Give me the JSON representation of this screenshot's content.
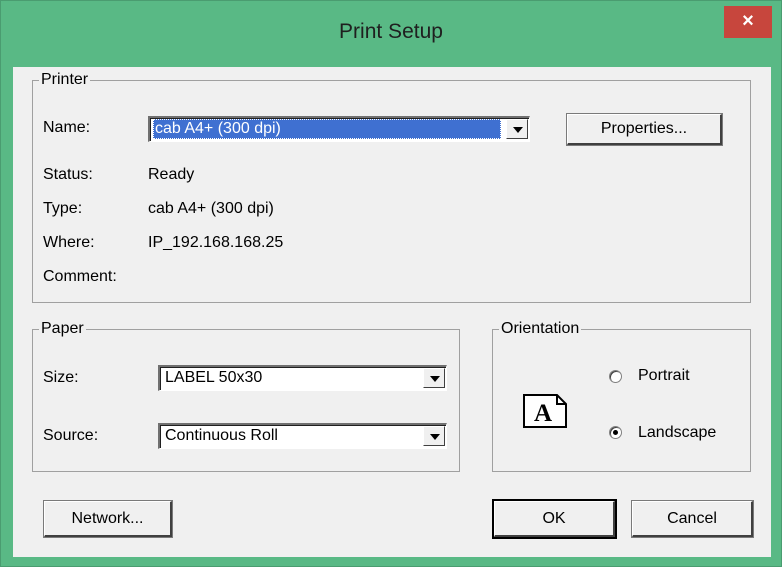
{
  "window": {
    "title": "Print Setup",
    "close_glyph": "×"
  },
  "printer": {
    "group_label": "Printer",
    "name_label": "Name:",
    "name_value": "cab A4+ (300 dpi)",
    "properties_button": "Properties...",
    "status_label": "Status:",
    "status_value": "Ready",
    "type_label": "Type:",
    "type_value": "cab A4+ (300 dpi)",
    "where_label": "Where:",
    "where_value": "IP_192.168.168.25",
    "comment_label": "Comment:",
    "comment_value": ""
  },
  "paper": {
    "group_label": "Paper",
    "size_label": "Size:",
    "size_value": "LABEL 50x30",
    "source_label": "Source:",
    "source_value": "Continuous Roll"
  },
  "orientation": {
    "group_label": "Orientation",
    "portrait_label": "Portrait",
    "landscape_label": "Landscape",
    "selected": "Landscape",
    "icon_letter": "A"
  },
  "buttons": {
    "network": "Network...",
    "ok": "OK",
    "cancel": "Cancel"
  },
  "colors": {
    "titlebar": "#59b985",
    "close": "#c7463d",
    "selection": "#3f70d1",
    "client": "#f0f0f0"
  }
}
